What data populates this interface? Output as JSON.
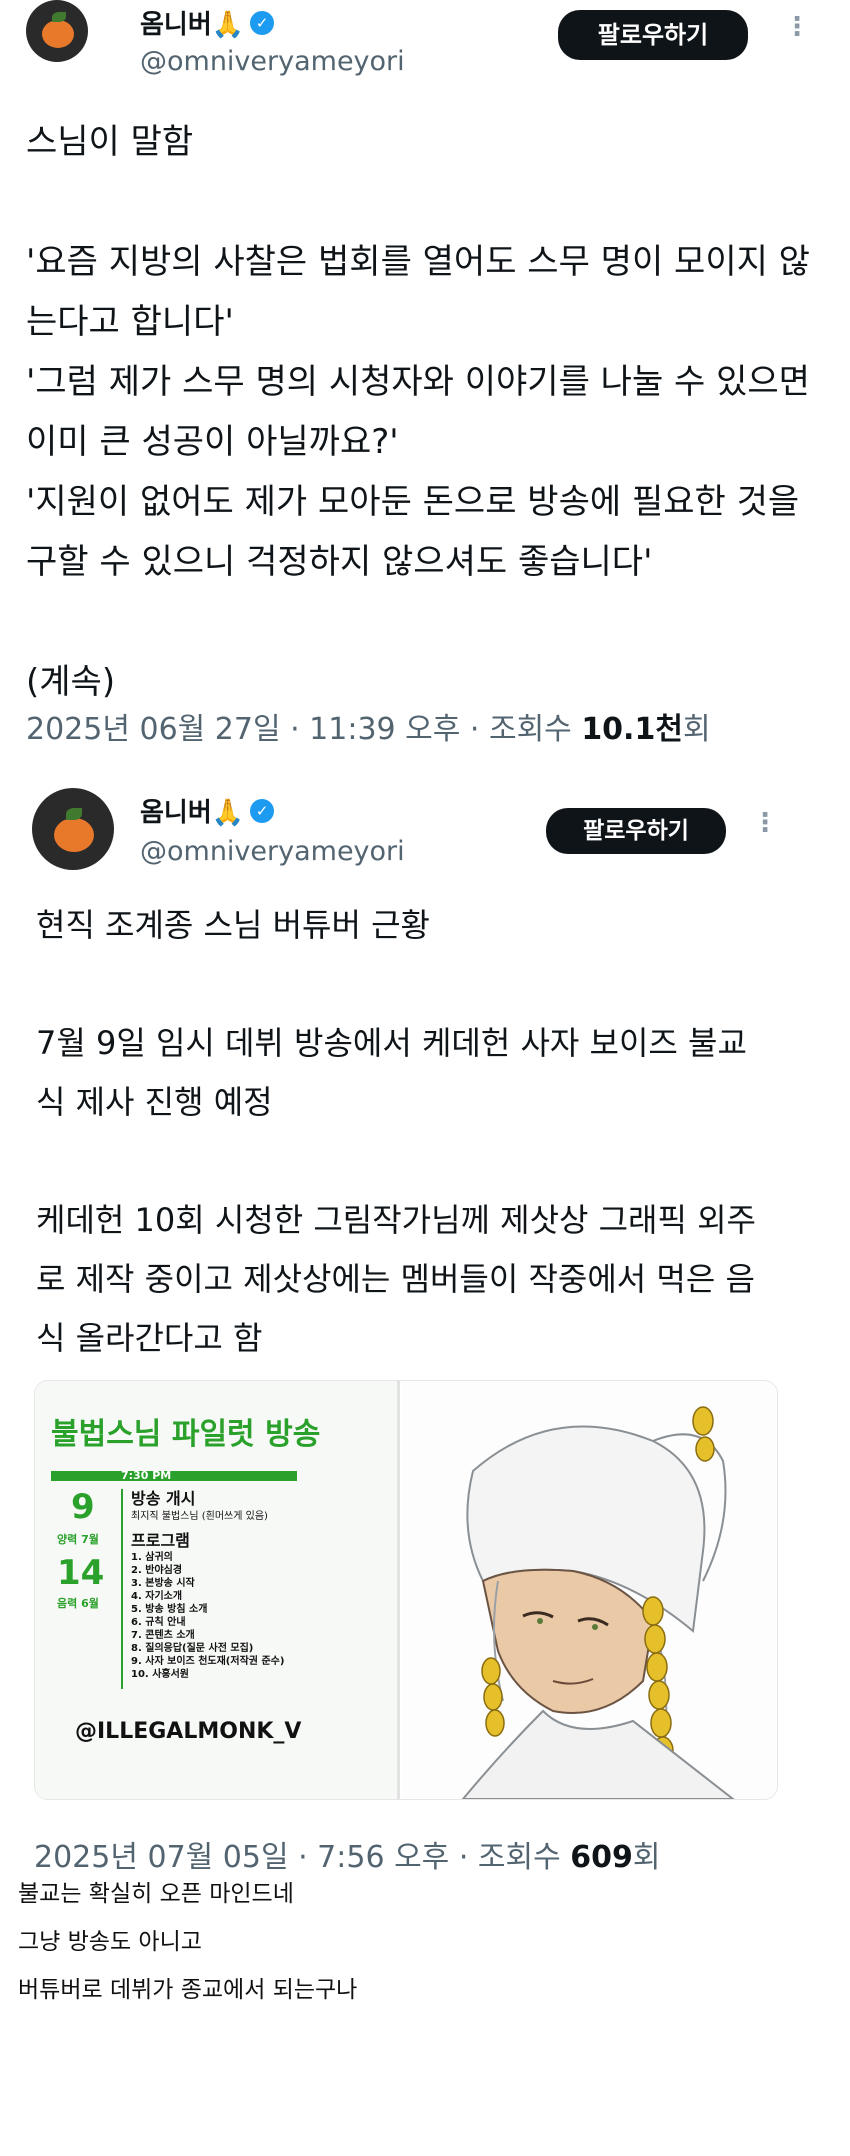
{
  "tweets": [
    {
      "name": "옴니버🙏",
      "handle": "@omniveryameyori",
      "follow_label": "팔로우하기",
      "more_glyph": "⋮",
      "body": "스님이 말함\n\n'요즘 지방의 사찰은 법회를 열어도 스무 명이 모이지 않는다고 합니다'\n'그럼 제가 스무 명의 시청자와 이야기를 나눌 수 있으면 이미 큰 성공이 아닐까요?'\n'지원이 없어도 제가 모아둔 돈으로 방송에 필요한 것을 구할 수 있으니 걱정하지 않으셔도 좋습니다'\n\n(계속)",
      "meta_prefix": "2025년 06월 27일 · 11:39 오후 · 조회수 ",
      "views": "10.1천",
      "meta_suffix": "회"
    },
    {
      "name": "옴니버🙏",
      "handle": "@omniveryameyori",
      "follow_label": "팔로우하기",
      "more_glyph": "⋮",
      "body": "현직 조계종 스님 버튜버 근황\n\n7월 9일 임시 데뷔 방송에서 케데헌 사자 보이즈 불교식 제사 진행 예정\n\n케데헌 10회 시청한 그림작가님께 제삿상 그래픽 외주로 제작 중이고 제삿상에는 멤버들이 작중에서 먹은 음식 올라간다고 함",
      "meta_prefix": "2025년 07월 05일 · 7:56 오후 · 조회수 ",
      "views": "609",
      "meta_suffix": "회"
    }
  ],
  "poster": {
    "title": "불법스님 파일럿 방송",
    "time": "7:30 PM",
    "day1": "9",
    "month1": "양력 7월",
    "day2": "14",
    "month2": "음력 6월",
    "show_title": "방송 개시",
    "show_sub": "최지직 불법스님 (흰머쓰게 있음)",
    "program_label": "프로그램",
    "program": [
      "1. 삼귀의",
      "2. 반야심경",
      "3. 본방송 시작",
      "4. 자기소개",
      "5. 방송 방침 소개",
      "6. 규칙 안내",
      "7. 콘텐츠 소개",
      "8. 질의응답(질문 사전 모집)",
      "9. 사자 보이즈 천도재(저작권 준수)",
      "10. 사홍서원"
    ],
    "channel": "@ILLEGALMONK_V"
  },
  "comments": [
    "불교는 확실히 오픈 마인드네",
    "그냥 방송도 아니고",
    "버튜버로 데뷔가 종교에서 되는구나"
  ],
  "colors": {
    "follow_bg": "#0f1419",
    "verified": "#1d9bf0",
    "poster_green": "#2aa12a",
    "meta_gray": "#536471"
  }
}
